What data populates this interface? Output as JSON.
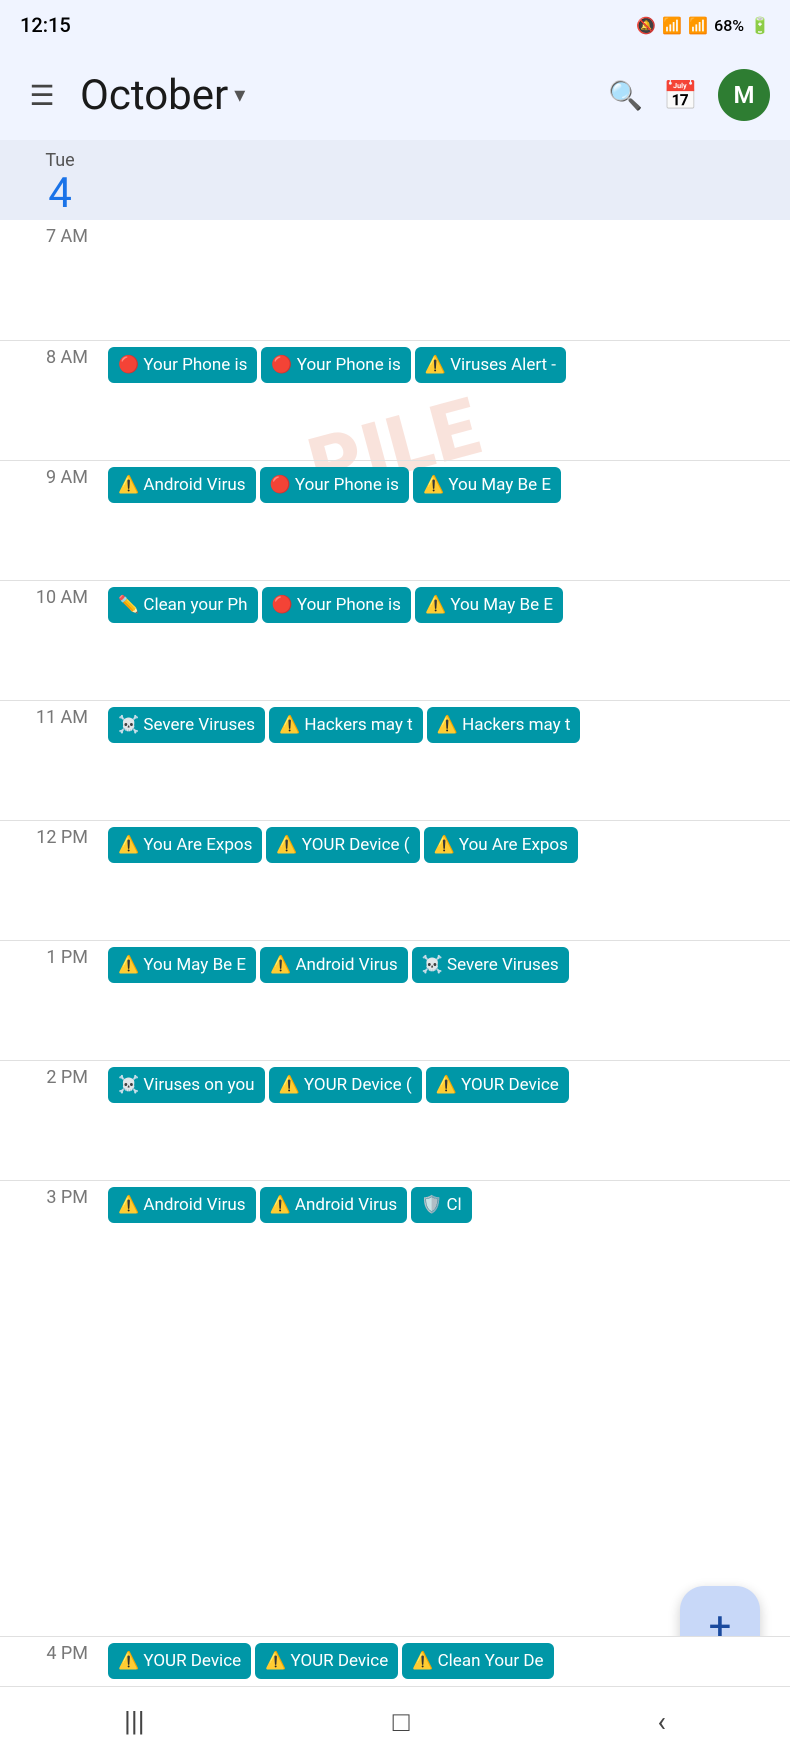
{
  "statusBar": {
    "time": "12:15",
    "battery": "68%",
    "icons": [
      "🔕",
      "📶",
      "📶"
    ]
  },
  "header": {
    "menuLabel": "☰",
    "title": "October",
    "dropdownIcon": "▾",
    "searchIcon": "🔍",
    "calendarIcon": "📅",
    "avatarLabel": "M"
  },
  "dayHeader": {
    "dayName": "Tue",
    "dayNumber": "4"
  },
  "timeSlots": [
    {
      "time": "7 AM",
      "events": []
    },
    {
      "time": "8 AM",
      "events": [
        {
          "icon": "🔴",
          "text": "Your Phone is"
        },
        {
          "icon": "🔴",
          "text": "Your Phone is"
        },
        {
          "icon": "⚠️",
          "text": "Viruses Alert -"
        }
      ]
    },
    {
      "time": "9 AM",
      "events": [
        {
          "icon": "⚠️",
          "text": "Android Virus"
        },
        {
          "icon": "🔴",
          "text": "Your Phone is"
        },
        {
          "icon": "⚠️",
          "text": "You May Be E"
        }
      ]
    },
    {
      "time": "10 AM",
      "events": [
        {
          "icon": "✏️",
          "text": "Clean your Ph"
        },
        {
          "icon": "🔴",
          "text": "Your Phone is"
        },
        {
          "icon": "⚠️",
          "text": "You May Be E"
        }
      ]
    },
    {
      "time": "11 AM",
      "events": [
        {
          "icon": "☠️",
          "text": "Severe Viruses"
        },
        {
          "icon": "⚠️",
          "text": "Hackers may t"
        },
        {
          "icon": "⚠️",
          "text": "Hackers may t"
        }
      ]
    },
    {
      "time": "12 PM",
      "events": [
        {
          "icon": "⚠️",
          "text": "You Are Expos"
        },
        {
          "icon": "⚠️",
          "text": "YOUR Device ("
        },
        {
          "icon": "⚠️",
          "text": "You Are Expos"
        }
      ]
    },
    {
      "time": "1 PM",
      "events": [
        {
          "icon": "⚠️",
          "text": "You May Be E"
        },
        {
          "icon": "⚠️",
          "text": "Android Virus"
        },
        {
          "icon": "☠️",
          "text": "Severe Viruses"
        }
      ]
    },
    {
      "time": "2 PM",
      "events": [
        {
          "icon": "☠️",
          "text": "Viruses on you"
        },
        {
          "icon": "⚠️",
          "text": "YOUR Device ("
        },
        {
          "icon": "⚠️",
          "text": "YOUR Device"
        }
      ]
    },
    {
      "time": "3 PM",
      "events": [
        {
          "icon": "⚠️",
          "text": "Android Virus"
        },
        {
          "icon": "⚠️",
          "text": "Android Virus"
        },
        {
          "icon": "🛡️",
          "text": "Cl"
        }
      ]
    }
  ],
  "partialSlot": {
    "time": "4 PM",
    "events": [
      {
        "icon": "⚠️",
        "text": "YOUR Device"
      },
      {
        "icon": "⚠️",
        "text": "YOUR Device"
      },
      {
        "icon": "⚠️",
        "text": "Clean Your De"
      }
    ]
  },
  "fab": {
    "icon": "+"
  },
  "bottomNav": {
    "items": [
      "|||",
      "□",
      "‹"
    ]
  },
  "watermark": "PILE"
}
